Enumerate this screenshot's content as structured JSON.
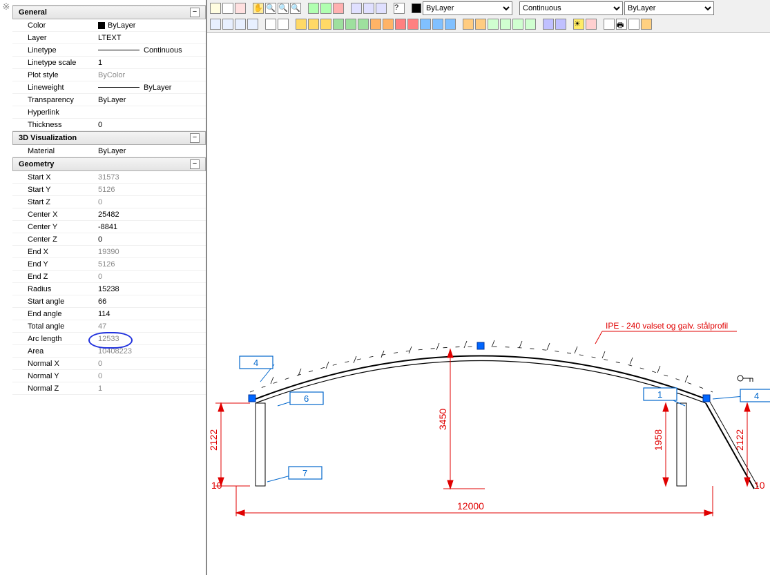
{
  "toolbar": {
    "layer_dropdown": "ByLayer",
    "linetype_dropdown": "Continuous",
    "lineweight_dropdown": "ByLayer"
  },
  "panel": {
    "sections": {
      "general": {
        "title": "General",
        "rows": [
          {
            "label": "Color",
            "value": "ByLayer",
            "swatch": true
          },
          {
            "label": "Layer",
            "value": "LTEXT"
          },
          {
            "label": "Linetype",
            "value": "Continuous",
            "line": true
          },
          {
            "label": "Linetype scale",
            "value": "1"
          },
          {
            "label": "Plot style",
            "value": "ByColor",
            "gray": true
          },
          {
            "label": "Lineweight",
            "value": "ByLayer",
            "line": true
          },
          {
            "label": "Transparency",
            "value": "ByLayer"
          },
          {
            "label": "Hyperlink",
            "value": ""
          },
          {
            "label": "Thickness",
            "value": "0"
          }
        ]
      },
      "visualization": {
        "title": "3D Visualization",
        "rows": [
          {
            "label": "Material",
            "value": "ByLayer"
          }
        ]
      },
      "geometry": {
        "title": "Geometry",
        "rows": [
          {
            "label": "Start X",
            "value": "31573",
            "gray": true
          },
          {
            "label": "Start Y",
            "value": "5126",
            "gray": true
          },
          {
            "label": "Start Z",
            "value": "0",
            "gray": true
          },
          {
            "label": "Center X",
            "value": "25482"
          },
          {
            "label": "Center Y",
            "value": "-8841"
          },
          {
            "label": "Center Z",
            "value": "0"
          },
          {
            "label": "End X",
            "value": "19390",
            "gray": true
          },
          {
            "label": "End Y",
            "value": "5126",
            "gray": true
          },
          {
            "label": "End Z",
            "value": "0",
            "gray": true
          },
          {
            "label": "Radius",
            "value": "15238"
          },
          {
            "label": "Start angle",
            "value": "66"
          },
          {
            "label": "End angle",
            "value": "114"
          },
          {
            "label": "Total angle",
            "value": "47",
            "gray": true
          },
          {
            "label": "Arc length",
            "value": "12533",
            "gray": true,
            "circled": true
          },
          {
            "label": "Area",
            "value": "10408223",
            "gray": true
          },
          {
            "label": "Normal X",
            "value": "0",
            "gray": true
          },
          {
            "label": "Normal Y",
            "value": "0",
            "gray": true
          },
          {
            "label": "Normal Z",
            "value": "1",
            "gray": true
          }
        ]
      }
    }
  },
  "drawing": {
    "note": "IPE - 240 valset og galv. stålprofil",
    "dims": {
      "span": "12000",
      "height_center": "3450",
      "left_col": "2122",
      "right_col_outer": "2122",
      "right_col": "1958",
      "left_small": "10",
      "right_small": "10"
    },
    "callouts": {
      "c4_left": "4",
      "c6": "6",
      "c7": "7",
      "c1": "1",
      "c4_right": "4"
    }
  }
}
